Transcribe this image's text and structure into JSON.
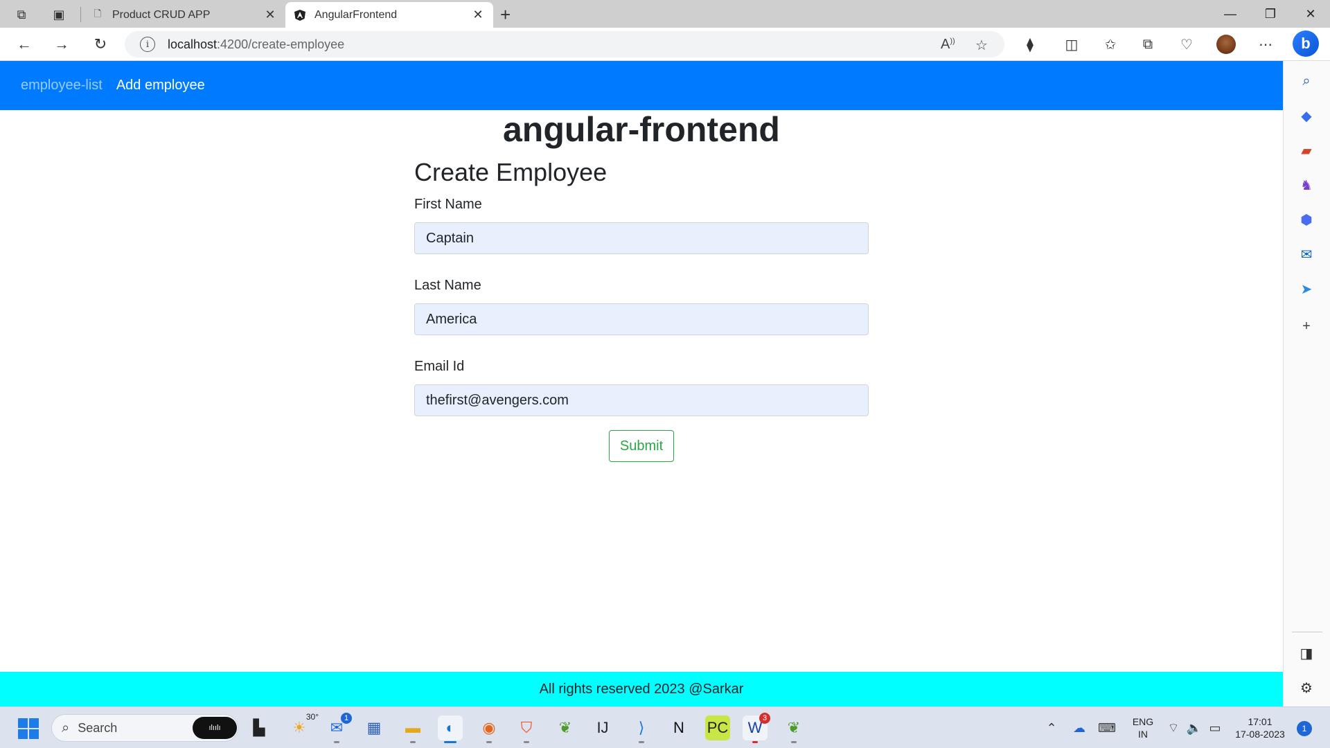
{
  "browser": {
    "tabs": [
      {
        "title": "Product CRUD APP",
        "active": false
      },
      {
        "title": "AngularFrontend",
        "active": true
      }
    ],
    "url_host": "localhost",
    "url_rest": ":4200/create-employee"
  },
  "navbar": {
    "link_list": "employee-list",
    "link_add": "Add employee"
  },
  "app": {
    "title": "angular-frontend"
  },
  "form": {
    "heading": "Create Employee",
    "first_name_label": "First Name",
    "first_name_value": "Captain",
    "last_name_label": "Last Name",
    "last_name_value": "America",
    "email_label": "Email Id",
    "email_value": "thefirst@avengers.com",
    "submit_label": "Submit"
  },
  "footer": {
    "text": "All rights reserved 2023 @Sarkar"
  },
  "taskbar": {
    "search_label": "Search",
    "weather_temp": "30°",
    "mail_badge": "1",
    "webex_badge": "3",
    "lang_line1": "ENG",
    "lang_line2": "IN",
    "time": "17:01",
    "date": "17-08-2023",
    "notification_count": "1"
  },
  "colors": {
    "navbar": "#007bff",
    "footer": "#00ffff",
    "submit": "#28a745",
    "input_fill": "#e8f0fe"
  }
}
